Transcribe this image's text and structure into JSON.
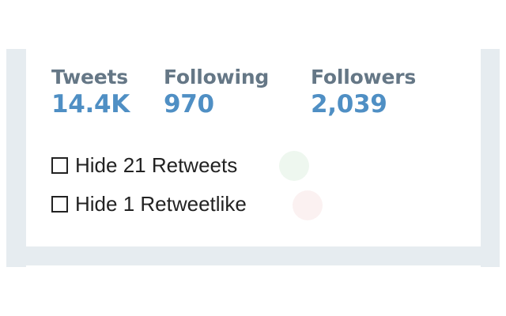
{
  "stats": {
    "tweets": {
      "label": "Tweets",
      "value": "14.4K"
    },
    "following": {
      "label": "Following",
      "value": "970"
    },
    "followers": {
      "label": "Followers",
      "value": "2,039"
    }
  },
  "options": {
    "hide_retweets": {
      "label": "Hide 21 Retweets",
      "checked": false,
      "indicator_color": "#eef7ef"
    },
    "hide_retweetlike": {
      "label": "Hide 1 Retweetlike",
      "checked": false,
      "indicator_color": "#fbf1f1"
    }
  },
  "colors": {
    "background": "#e6ecf0",
    "card": "#ffffff",
    "stat_label": "#657786",
    "stat_value": "#4f8fc4",
    "text": "#222222"
  }
}
